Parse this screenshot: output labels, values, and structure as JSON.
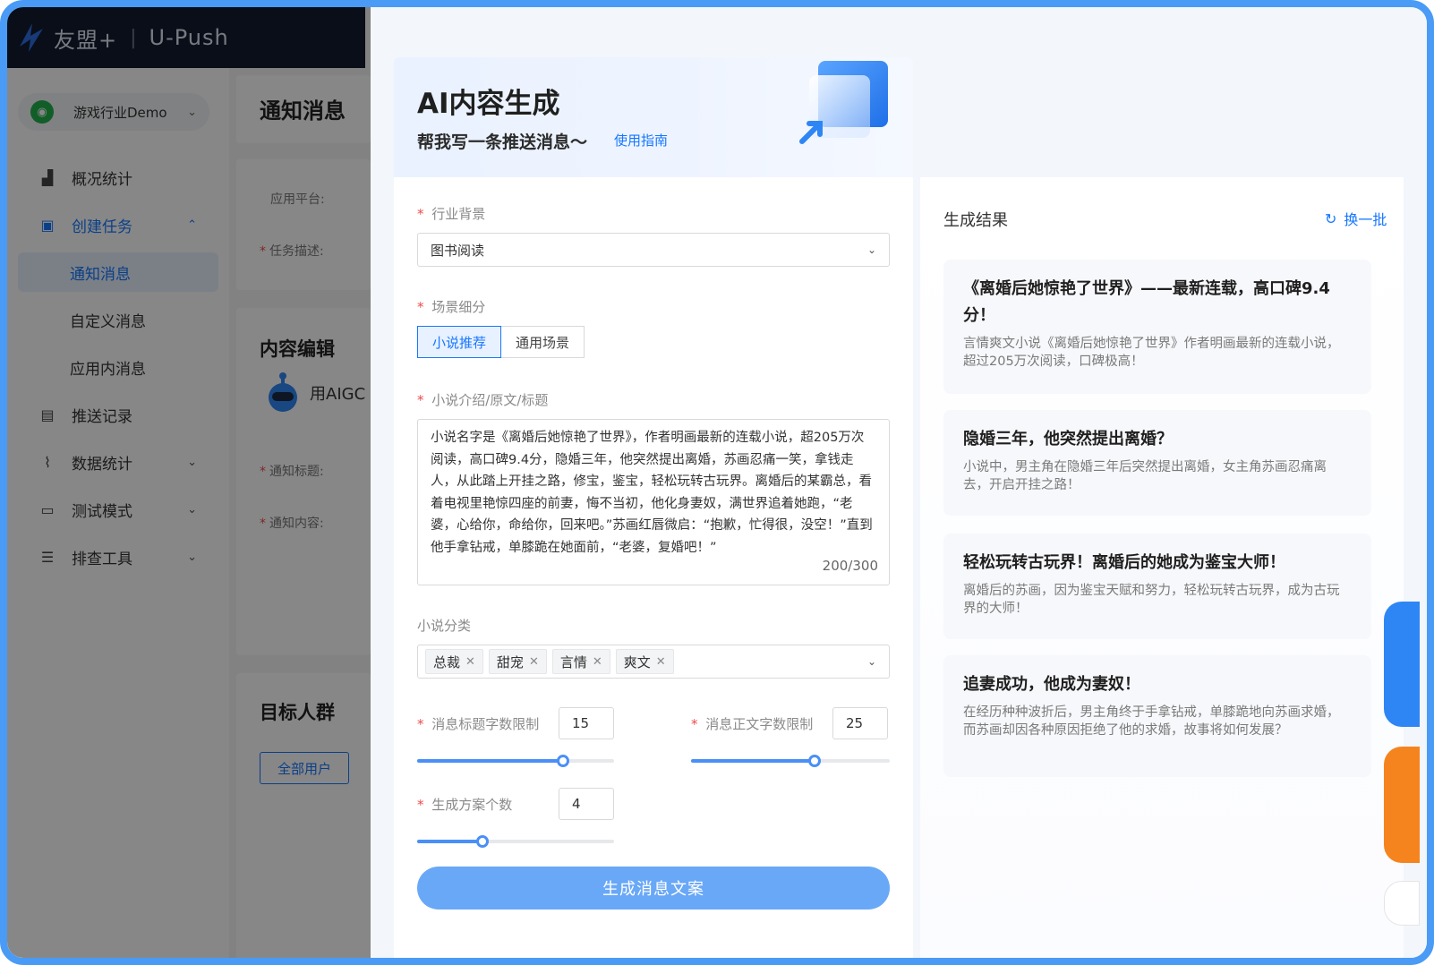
{
  "topbar": {
    "brand": "友盟+",
    "separator": "|",
    "product": "U-Push"
  },
  "sidebar": {
    "app_name": "游戏行业Demo",
    "items": [
      {
        "label": "概况统计",
        "icon": "chart-icon"
      },
      {
        "label": "创建任务",
        "icon": "task-icon"
      },
      {
        "label": "通知消息"
      },
      {
        "label": "自定义消息"
      },
      {
        "label": "应用内消息"
      },
      {
        "label": "推送记录",
        "icon": "record-icon"
      },
      {
        "label": "数据统计",
        "icon": "line-chart-icon"
      },
      {
        "label": "测试模式",
        "icon": "monitor-icon"
      },
      {
        "label": "排查工具",
        "icon": "list-icon"
      }
    ]
  },
  "main": {
    "page_title": "通知消息",
    "platform_label": "应用平台:",
    "task_desc_label": "任务描述:",
    "content_title": "内容编辑",
    "aigc_text": "用AIGC",
    "notice_title_label": "通知标题:",
    "notice_content_label": "通知内容:",
    "audience_title": "目标人群",
    "all_users": "全部用户"
  },
  "drawer": {
    "title": "AI内容生成",
    "subtitle": "帮我写一条推送消息～",
    "guide_link": "使用指南",
    "industry_label": "行业背景",
    "industry_value": "图书阅读",
    "scene_label": "场景细分",
    "scene_options": [
      "小说推荐",
      "通用场景"
    ],
    "scene_selected": "小说推荐",
    "intro_label": "小说介绍/原文/标题",
    "intro_text": "小说名字是《离婚后她惊艳了世界》，作者明画最新的连载小说，超205万次阅读，高口碑9.4分，隐婚三年，他突然提出离婚，苏画忍痛一笑，拿钱走人，从此踏上开挂之路，修宝，鉴宝，轻松玩转古玩界。离婚后的某霸总，看着电视里艳惊四座的前妻，悔不当初，他化身妻奴，满世界追着她跑，“老婆，心给你，命给你，回来吧。”苏画红唇微启：“抱歉，忙得很，没空！”直到他手拿钻戒，单膝跪在她面前，“老婆，复婚吧！”",
    "intro_counter": "200/300",
    "category_label": "小说分类",
    "categories": [
      "总裁",
      "甜宠",
      "言情",
      "爽文"
    ],
    "title_limit_label": "消息标题字数限制",
    "title_limit_value": "15",
    "title_limit_fraction": 0.74,
    "body_limit_label": "消息正文字数限制",
    "body_limit_value": "25",
    "body_limit_fraction": 0.62,
    "count_label": "生成方案个数",
    "count_value": "4",
    "count_fraction": 0.33,
    "generate_button": "生成消息文案"
  },
  "results": {
    "title": "生成结果",
    "refresh": "换一批",
    "items": [
      {
        "title": "《离婚后她惊艳了世界》——最新连载，高口碑9.4分！",
        "body": "言情爽文小说《离婚后她惊艳了世界》作者明画最新的连载小说，超过205万次阅读，口碑极高！"
      },
      {
        "title": "隐婚三年，他突然提出离婚？",
        "body": "小说中，男主角在隐婚三年后突然提出离婚，女主角苏画忍痛离去，开启开挂之路！"
      },
      {
        "title": "轻松玩转古玩界！离婚后的她成为鉴宝大师！",
        "body": "离婚后的苏画，因为鉴宝天赋和努力，轻松玩转古玩界，成为古玩界的大师！"
      },
      {
        "title": "追妻成功，他成为妻奴！",
        "body": "在经历种种波折后，男主角终于手拿钻戒，单膝跪地向苏画求婚，而苏画却因各种原因拒绝了他的求婚，故事将如何发展？"
      }
    ]
  },
  "colors": {
    "accent": "#1677ff",
    "frame": "#4a9bf5",
    "topbar": "#121b2e",
    "generate_button": "#69a8f7"
  }
}
